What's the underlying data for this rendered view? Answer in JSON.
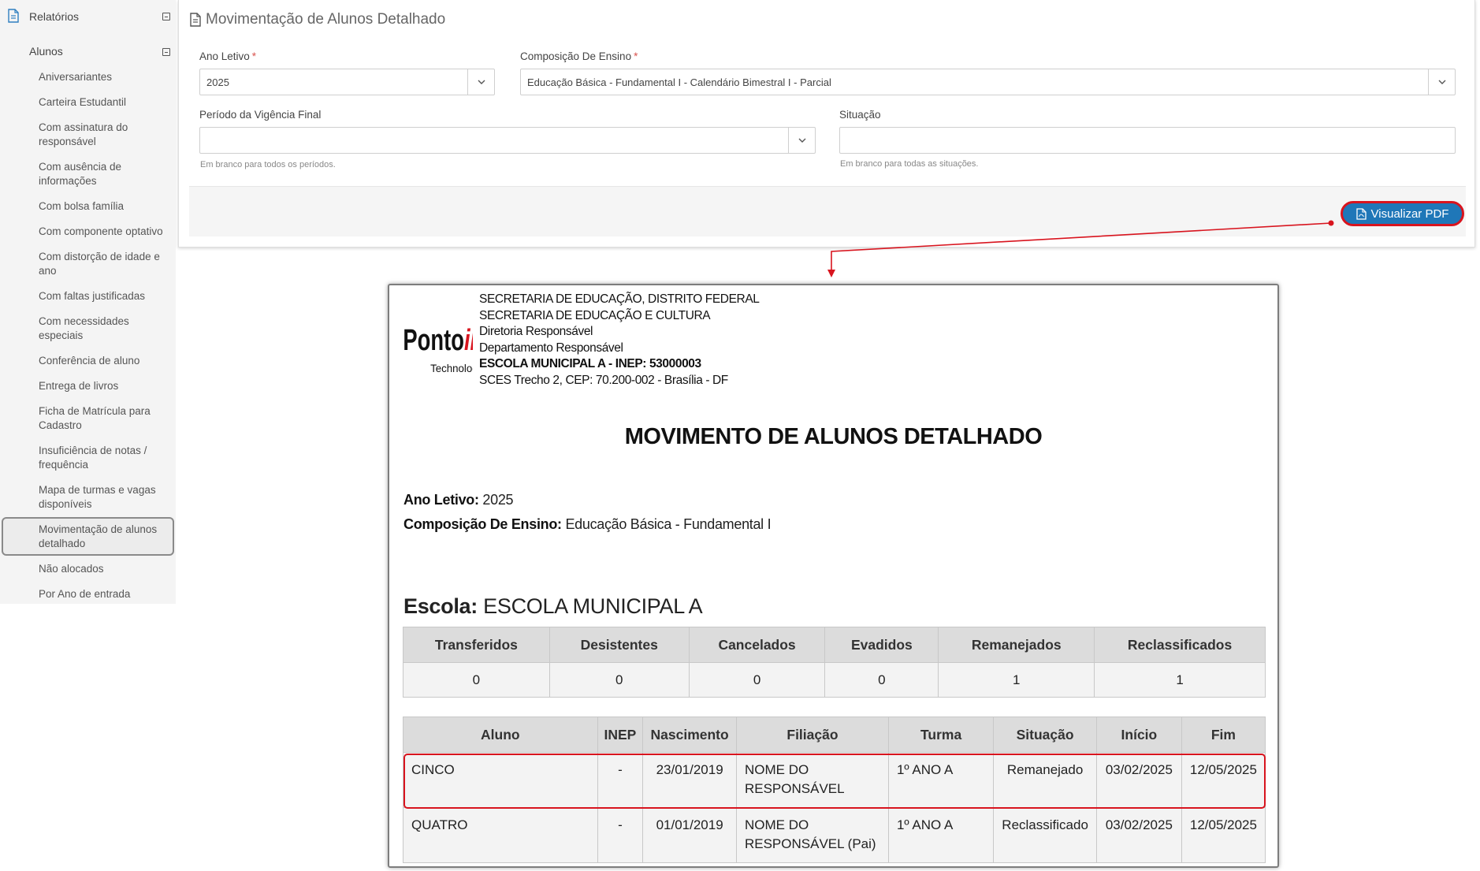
{
  "sidebar": {
    "section_label": "Relatórios",
    "group_label": "Alunos",
    "items": [
      "Aniversariantes",
      "Carteira Estudantil",
      "Com assinatura do responsável",
      "Com ausência de informações",
      "Com bolsa família",
      "Com componente optativo",
      "Com distorção de idade e ano",
      "Com faltas justificadas",
      "Com necessidades especiais",
      "Conferência de aluno",
      "Entrega de livros",
      "Ficha de Matrícula para Cadastro",
      "Insuficiência de notas / frequência",
      "Mapa de turmas e vagas disponíveis",
      "Movimentação de alunos detalhado",
      "Não alocados",
      "Por Ano de entrada"
    ],
    "active_item": "Movimentação de alunos detalhado"
  },
  "form": {
    "title": "Movimentação de Alunos Detalhado",
    "ano_letivo_label": "Ano Letivo",
    "ano_letivo_value": "2025",
    "composicao_label": "Composição De Ensino",
    "composicao_value": "Educação Básica - Fundamental I - Calendário Bimestral I - Parcial",
    "periodo_label": "Período da Vigência Final",
    "periodo_value": "",
    "periodo_help": "Em branco para todos os períodos.",
    "situacao_label": "Situação",
    "situacao_value": "",
    "situacao_help": "Em branco para todas as situações.",
    "required_mark": "*",
    "pdf_button": "Visualizar PDF"
  },
  "report": {
    "logo_text": "PontoiD",
    "logo_sub": "Technology",
    "header_lines": [
      "SECRETARIA DE EDUCAÇÃO, DISTRITO FEDERAL",
      "SECRETARIA DE EDUCAÇÃO E CULTURA",
      "Diretoria Responsável",
      "Departamento Responsável",
      "ESCOLA MUNICIPAL A - INEP: 53000003",
      "SCES Trecho 2, CEP: 70.200-002 - Brasília - DF"
    ],
    "title": "MOVIMENTO DE ALUNOS DETALHADO",
    "ano_letivo_label": "Ano Letivo:",
    "ano_letivo_value": "2025",
    "composicao_label": "Composição De Ensino:",
    "composicao_value": "Educação Básica - Fundamental I",
    "escola_label": "Escola:",
    "escola_value": "ESCOLA MUNICIPAL A",
    "counts": {
      "headers": [
        "Transferidos",
        "Desistentes",
        "Cancelados",
        "Evadidos",
        "Remanejados",
        "Reclassificados"
      ],
      "values": [
        "0",
        "0",
        "0",
        "0",
        "1",
        "1"
      ]
    },
    "students": {
      "headers": [
        "Aluno",
        "INEP",
        "Nascimento",
        "Filiação",
        "Turma",
        "Situação",
        "Início",
        "Fim"
      ],
      "rows": [
        [
          "CINCO",
          "-",
          "23/01/2019",
          "NOME DO RESPONSÁVEL",
          "1º ANO A",
          "Remanejado",
          "03/02/2025",
          "12/05/2025"
        ],
        [
          "QUATRO",
          "-",
          "01/01/2019",
          "NOME DO RESPONSÁVEL (Pai)",
          "1º ANO A",
          "Reclassificado",
          "03/02/2025",
          "12/05/2025"
        ]
      ]
    }
  },
  "colors": {
    "accent_button": "#1f77b8",
    "highlight": "#d8141e",
    "logo_red": "#d8141e",
    "required": "#d9534f"
  }
}
